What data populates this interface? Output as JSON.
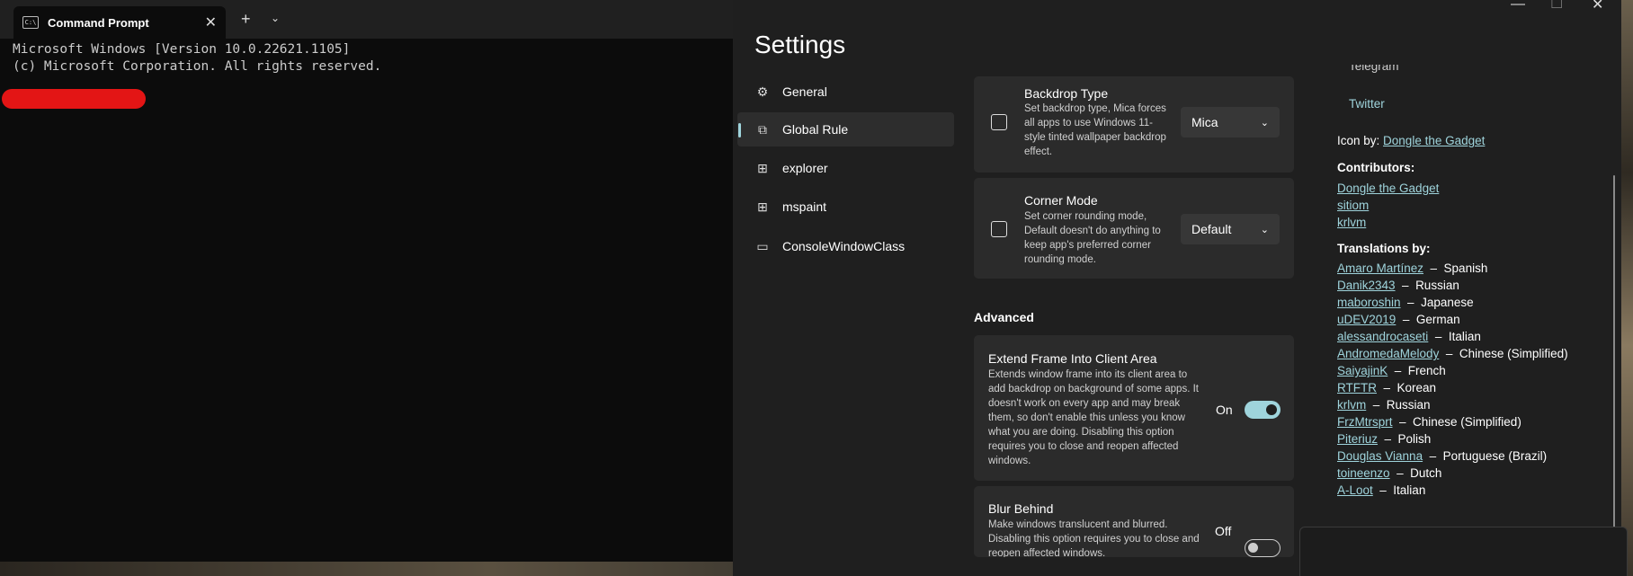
{
  "terminal": {
    "tab_title": "Command Prompt",
    "tab_icon": "cmd-icon",
    "new_tab": "+",
    "dropdown": "⌄",
    "close": "✕",
    "lines": [
      "Microsoft Windows [Version 10.0.22621.1105]",
      "(c) Microsoft Corporation. All rights reserved."
    ]
  },
  "settings": {
    "title": "Settings",
    "window_controls": {
      "minimize": "—",
      "maximize": "☐",
      "close": "✕"
    },
    "nav": [
      {
        "label": "General",
        "icon": "gear-icon"
      },
      {
        "label": "Global Rule",
        "icon": "windows-icon",
        "selected": true
      },
      {
        "label": "explorer",
        "icon": "app-icon"
      },
      {
        "label": "mspaint",
        "icon": "app-icon"
      },
      {
        "label": "ConsoleWindowClass",
        "icon": "window-icon"
      }
    ],
    "cards": {
      "backdrop": {
        "title": "Backdrop Type",
        "desc": "Set backdrop type, Mica forces all apps to use Windows 11-style tinted wallpaper backdrop effect.",
        "value": "Mica"
      },
      "corner": {
        "title": "Corner Mode",
        "desc": "Set corner rounding mode, Default doesn't do anything to keep app's preferred corner rounding mode.",
        "value": "Default"
      },
      "advanced_label": "Advanced",
      "extend": {
        "title": "Extend Frame Into Client Area",
        "desc": "Extends window frame into its client area to add backdrop on background of some apps. It doesn't work on every app and may break them, so don't enable this unless you know what you are doing. Disabling this option requires you to close and reopen affected windows.",
        "state": "On"
      },
      "blur": {
        "title": "Blur Behind",
        "desc": "Make windows translucent and blurred. Disabling this option requires you to close and reopen affected windows.",
        "state": "Off"
      }
    },
    "about": {
      "telegram": "Telegram",
      "twitter": "Twitter",
      "icon_by_label": "Icon by:",
      "icon_by": "Dongle the Gadget",
      "contributors_label": "Contributors:",
      "contributors": [
        "Dongle the Gadget",
        "sitiom",
        "krlvm"
      ],
      "translations_label": "Translations by:",
      "translations": [
        {
          "name": "Amaro Martínez",
          "lang": "Spanish"
        },
        {
          "name": "Danik2343",
          "lang": "Russian"
        },
        {
          "name": "maboroshin",
          "lang": "Japanese"
        },
        {
          "name": "uDEV2019",
          "lang": "German"
        },
        {
          "name": "alessandrocaseti",
          "lang": "Italian"
        },
        {
          "name": "AndromedaMelody",
          "lang": "Chinese (Simplified)"
        },
        {
          "name": "SaiyajinK",
          "lang": "French"
        },
        {
          "name": "RTFTR",
          "lang": "Korean"
        },
        {
          "name": "krlvm",
          "lang": "Russian"
        },
        {
          "name": "FrzMtrsprt",
          "lang": "Chinese (Simplified)"
        },
        {
          "name": "Piteriuz",
          "lang": "Polish"
        },
        {
          "name": "Douglas Vianna",
          "lang": "Portuguese (Brazil)"
        },
        {
          "name": "toineenzo",
          "lang": "Dutch"
        },
        {
          "name": "A-Loot",
          "lang": "Italian"
        }
      ]
    },
    "accent_color": "#9fd4dc"
  }
}
